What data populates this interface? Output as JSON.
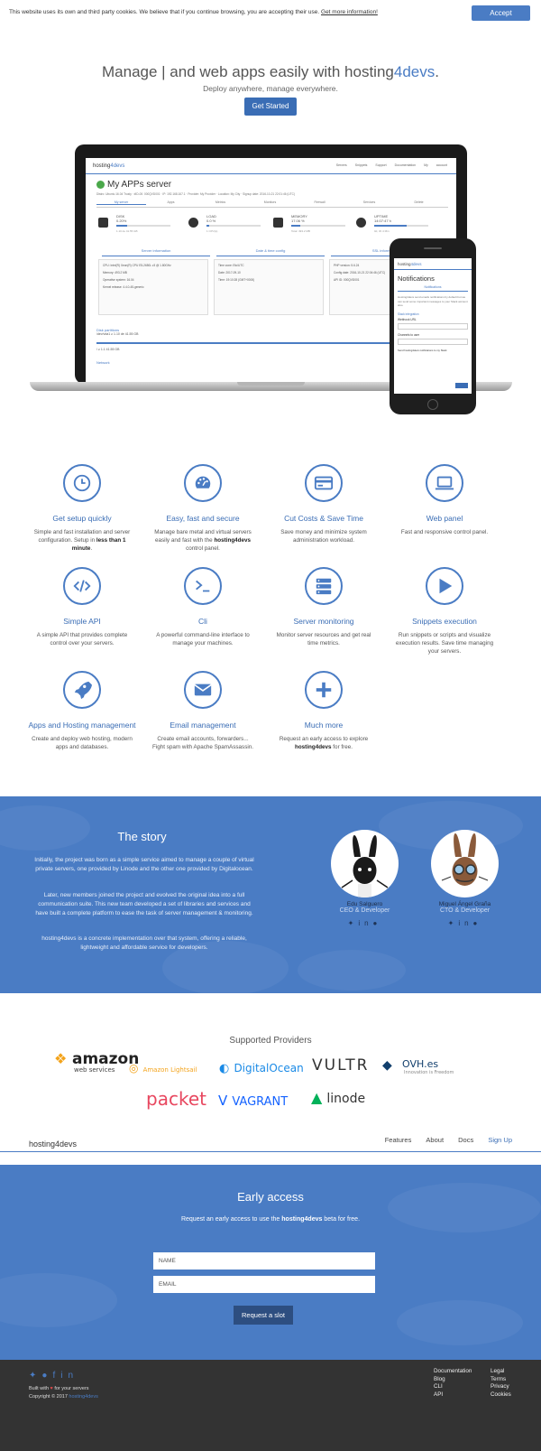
{
  "cookie": {
    "text": "This website uses its own and third party cookies. We believe that if you continue browsing, you are accepting their use.",
    "link": "Get more information!",
    "accept": "Accept"
  },
  "hero": {
    "title_prefix": "Manage | and web apps easily with hosting",
    "title_brand": "4devs",
    "title_suffix": ".",
    "subtitle": "Deploy anywhere, manage everywhere.",
    "cta": "Get Started"
  },
  "screen": {
    "logo_a": "hosting",
    "logo_b": "4devs",
    "menu": "Servers Snippets Support Documentation My account",
    "server_title": "My APPs server",
    "meta": "Distro: Ubuntu 16.04 Trusty  ·  #ID-00: 000QVD001  ·  IP: 192.168.167.1  ·  Provider: My Provider  ·  Location: My City  ·  Signup date: 2016-10-21 22:01:46 (UTC)",
    "tabs": [
      "My server",
      "Apps",
      "Metrics",
      "Monitors",
      "Firewall",
      "Services",
      "Delete"
    ],
    "stats": [
      {
        "label": "DISK",
        "value": "0.20%",
        "sub": "1.10 de 41.55 GB",
        "fill": 0.2
      },
      {
        "label": "LOAD",
        "value": "0.0 %",
        "sub": "1 CPU(s)",
        "fill": 0.05
      },
      {
        "label": "MEMORY",
        "value": "17.06 %",
        "sub": "Total: 493.2 MB",
        "fill": 0.17
      },
      {
        "label": "UPTIME",
        "value": "14:07:47 h",
        "sub": "0d, 3h 4 Min",
        "fill": 0.6
      }
    ],
    "sections": [
      "Server information",
      "Date & time config",
      "SSL information"
    ],
    "panels": [
      [
        "CPU: Intel(R) Xeon(R) CPU E5-2650L v3 @ 1.80GHz",
        "Memory: 493.2 MB",
        "Operative system: 16.04",
        "Kernel release: 4.4.0-45-generic"
      ],
      [
        "Time zone: Etc/UTC",
        "Date: 2017-09-10",
        "Time: 19:10:28 (GMT+0000)"
      ],
      [
        "PHP version: 5.6.24",
        "Config date: 2016-10-21 22:04:46 (UTC)",
        "API ID: 000QVD001"
      ]
    ],
    "disk_title": "Disk partitions",
    "disk_line1": "/dev/vda1 ≥ 1.10 de 41.55 GB",
    "disk_line2": "/ ≥ 1.1 41.55 GB",
    "network": "Network"
  },
  "phone": {
    "logo_a": "hosting",
    "logo_b": "4devs",
    "title": "Notifications",
    "tab": "Notifications",
    "text": "Hosting4devs send emails notifications by default but we can send some important messages to your Slack account also.",
    "slack": "Slack integration",
    "webhook": "Webhook URL",
    "channel": "Channels to user",
    "check": "Send hosting4devs notifications to my Slack"
  },
  "features": [
    {
      "title": "Get setup quickly",
      "desc": "Simple and fast installation and server configuration. Setup in",
      "bold": "less than 1 minute",
      "after": ".",
      "icon": "clock-icon"
    },
    {
      "title": "Easy, fast and secure",
      "desc": "Manage bare metal and virtual servers easily and fast with the",
      "bold": "hosting4devs",
      "after": " control panel.",
      "icon": "gauge-icon"
    },
    {
      "title": "Cut Costs & Save Time",
      "desc": "Save money and minimize system administration workload.",
      "bold": "",
      "after": "",
      "icon": "credit-card-icon"
    },
    {
      "title": "Web panel",
      "desc": "Fast and responsive control panel.",
      "bold": "",
      "after": "",
      "icon": "laptop-icon"
    },
    {
      "title": "Simple API",
      "desc": "A simple API that provides complete control over your servers.",
      "bold": "",
      "after": "",
      "icon": "code-icon"
    },
    {
      "title": "Cli",
      "desc": "A powerful command-line interface to manage your machines.",
      "bold": "",
      "after": "",
      "icon": "terminal-icon"
    },
    {
      "title": "Server monitoring",
      "desc": "Monitor server resources and get real time metrics.",
      "bold": "",
      "after": "",
      "icon": "server-icon"
    },
    {
      "title": "Snippets execution",
      "desc": "Run snippets or scripts and visualize execution results. Save time managing your servers.",
      "bold": "",
      "after": "",
      "icon": "play-icon"
    },
    {
      "title": "Apps and Hosting management",
      "desc": "Create and deploy web hosting, modern apps and databases.",
      "bold": "",
      "after": "",
      "icon": "rocket-icon"
    },
    {
      "title": "Email management",
      "desc": "Create email accounts, forwarders... Fight spam with Apache SpamAssassin.",
      "bold": "",
      "after": "",
      "icon": "envelope-icon"
    },
    {
      "title": "Much more",
      "desc": "Request an early access to explore",
      "bold": "hosting4devs",
      "after": " for free.",
      "icon": "plus-icon"
    }
  ],
  "story": {
    "title": "The story",
    "p1": "Initially, the project was born as a simple service aimed to manage a couple of virtual private servers, one provided by Linode and the other one provided by Digitalocean.",
    "p2": "Later, new members joined the project and evolved the original idea into a full communication suite. This new team developed a set of libraries and services and have built a complete platform to ease the task of server management & monitoring.",
    "p3": "hosting4devs is a concrete implementation over that system, offering a reliable, lightweight and affordable service for developers.",
    "members": [
      {
        "name": "Edu Salguero",
        "role": "CEO & Developer"
      },
      {
        "name": "Miguel Ángel Graña",
        "role": "CTO & Developer"
      }
    ]
  },
  "providers": {
    "title": "Supported Providers",
    "names": [
      "amazon",
      "web services",
      "Amazon Lightsail",
      "DigitalOcean",
      "VULTR",
      "OVH.es",
      "Innovation is Freedom",
      "packet",
      "VAGRANT",
      "linode"
    ]
  },
  "footer_nav": {
    "logo": "hosting4devs",
    "links": [
      "Features",
      "About",
      "Docs",
      "Sign Up"
    ]
  },
  "early": {
    "title": "Early access",
    "sub_a": "Request an early access to use the ",
    "sub_b": "hosting4devs",
    "sub_c": " beta for free.",
    "name_ph": "NAME",
    "email_ph": "EMAIL",
    "button": "Request a slot"
  },
  "footer": {
    "built": "Built with",
    "built_after": " for your servers",
    "copyright": "Copyright © 2017 ",
    "copyright_brand": "hosting4devs",
    "col1": [
      "Documentation",
      "Blog",
      "CLI",
      "API"
    ],
    "col2": [
      "Legal",
      "Terms",
      "Privacy",
      "Cookies"
    ]
  },
  "colors": {
    "accent": "#4a7cc4",
    "dark": "#333333",
    "button": "#3a6db5"
  }
}
